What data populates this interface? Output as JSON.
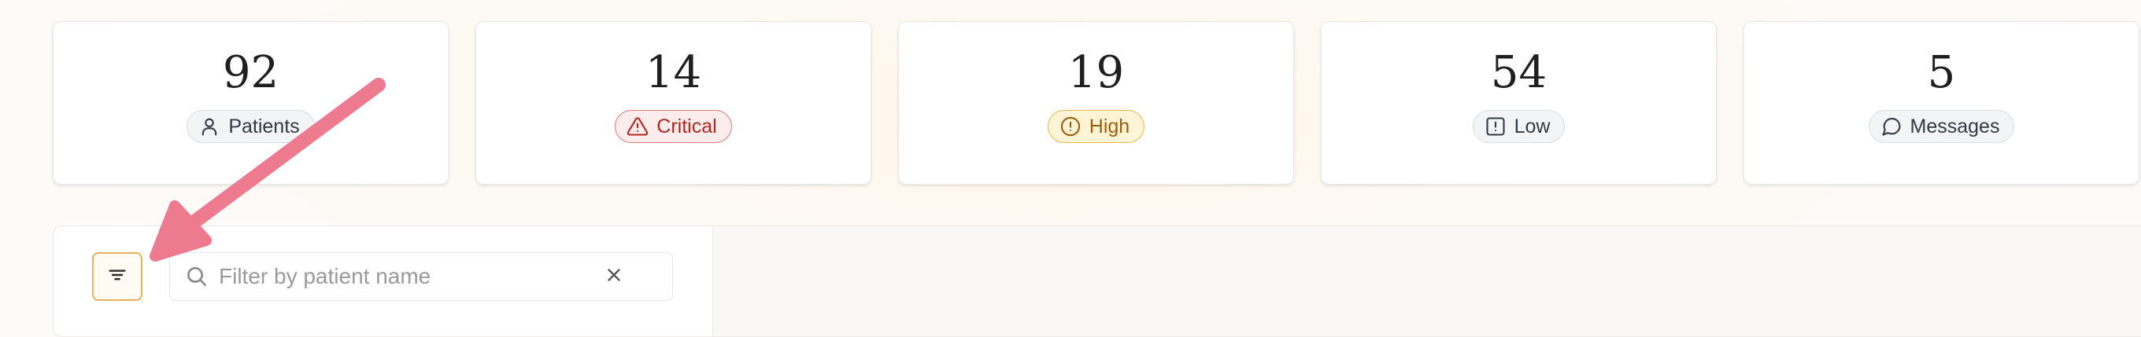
{
  "stats": [
    {
      "value": "92",
      "label": "Patients",
      "icon": "user-icon"
    },
    {
      "value": "14",
      "label": "Critical",
      "icon": "alert-triangle-icon"
    },
    {
      "value": "19",
      "label": "High",
      "icon": "alert-circle-icon"
    },
    {
      "value": "54",
      "label": "Low",
      "icon": "alert-square-icon"
    },
    {
      "value": "5",
      "label": "Messages",
      "icon": "message-circle-icon"
    }
  ],
  "filter": {
    "search_placeholder": "Filter by patient name",
    "search_value": "",
    "toggle_icon": "filter-lines-icon",
    "clear_icon": "close-icon"
  },
  "colors": {
    "critical_bg": "#fdecec",
    "critical_border": "#e57b7b",
    "critical_text": "#b3261e",
    "high_bg": "#fff5d6",
    "high_border": "#eab64a",
    "high_text": "#a15c07",
    "accent": "#e9b15a",
    "annotation_arrow": "#ee7a8f"
  }
}
